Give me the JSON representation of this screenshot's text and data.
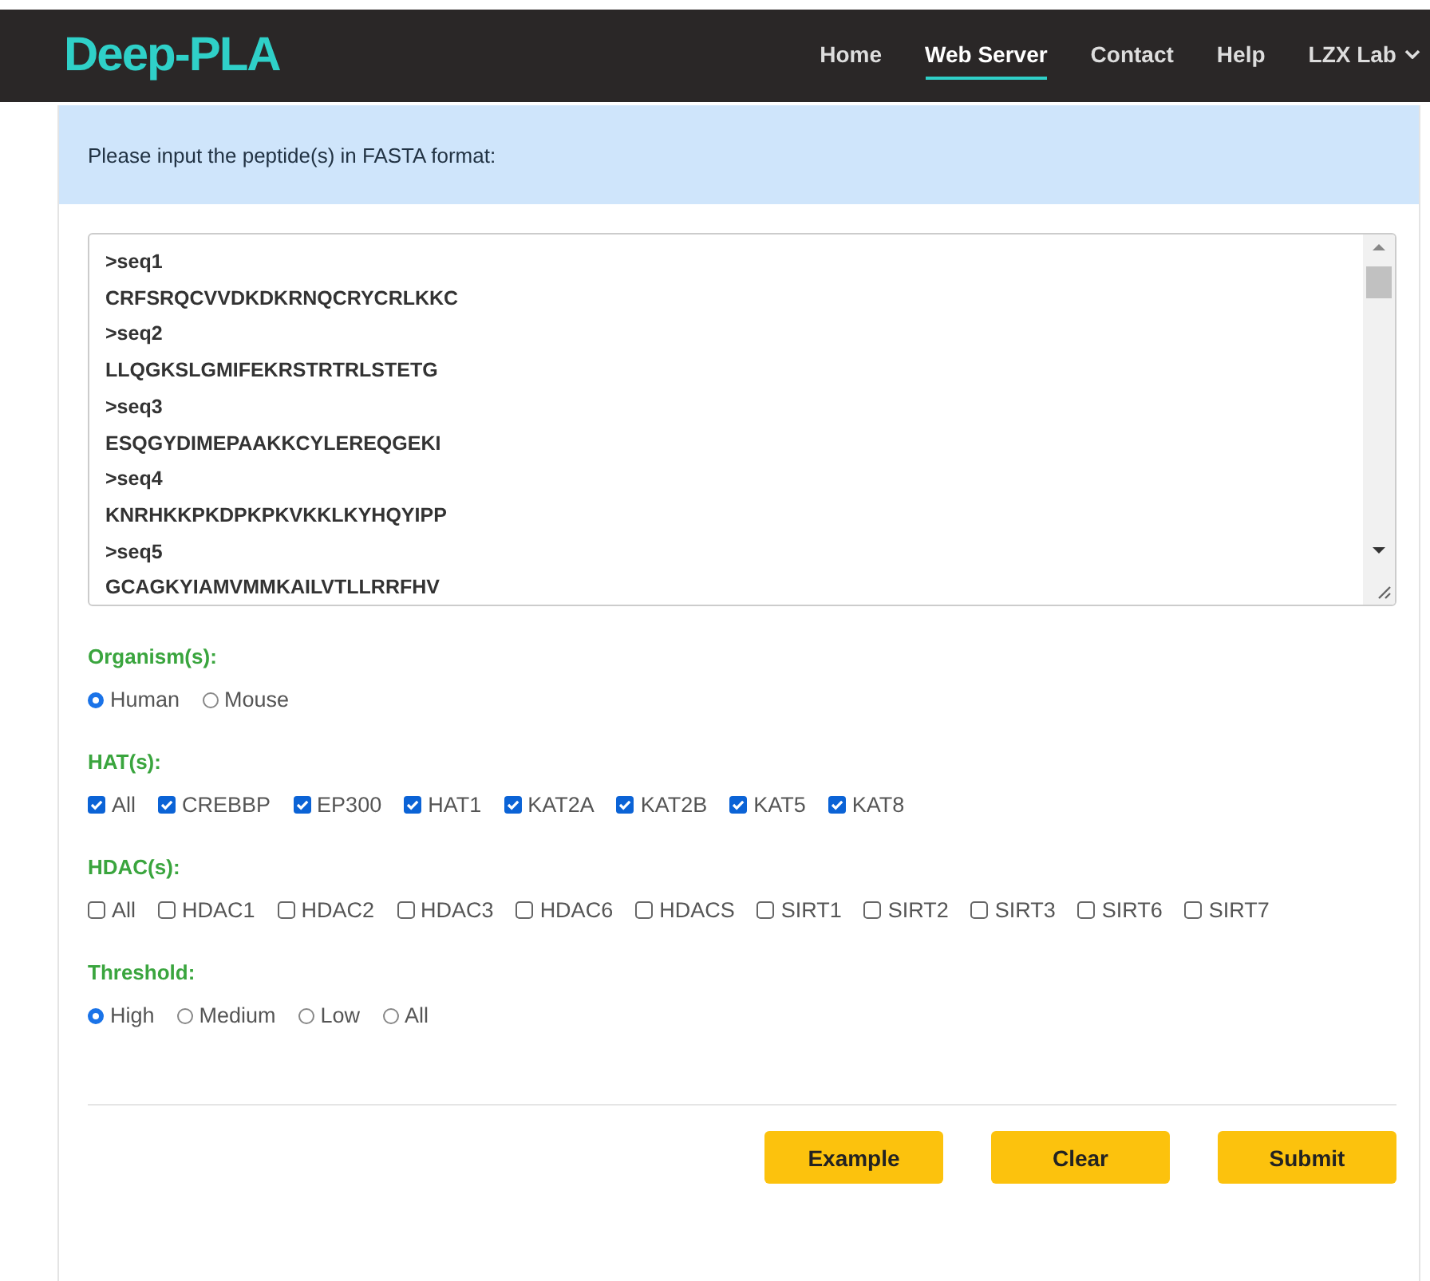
{
  "header": {
    "logo": "Deep-PLA",
    "nav": [
      {
        "label": "Home",
        "selected": false
      },
      {
        "label": "Web Server",
        "selected": true
      },
      {
        "label": "Contact",
        "selected": false
      },
      {
        "label": "Help",
        "selected": false
      },
      {
        "label": "LZX Lab",
        "selected": false,
        "dropdown": true
      }
    ]
  },
  "prompt": "Please input the peptide(s) in FASTA format:",
  "sequence_input": {
    "lines": [
      ">seq1",
      "CRFSRQCVVDKDKRNQCRYCRLKKC",
      ">seq2",
      "LLQGKSLGMIFEKRSTRTRLSTETG",
      ">seq3",
      "ESQGYDIMEPAAKKCYLEREQGEKI",
      ">seq4",
      "KNRHKKPKDPKPKVKKLKYHQYIPP",
      ">seq5",
      "GCAGKYIAMVMMKAILVTLLRRFHV"
    ]
  },
  "groups": [
    {
      "title": "Organism(s):",
      "kind": "radio",
      "options": [
        {
          "label": "Human",
          "selected": true
        },
        {
          "label": "Mouse",
          "selected": false
        }
      ]
    },
    {
      "title": "HAT(s):",
      "kind": "checkbox",
      "options": [
        {
          "label": "All",
          "checked": true
        },
        {
          "label": "CREBBP",
          "checked": true
        },
        {
          "label": "EP300",
          "checked": true
        },
        {
          "label": "HAT1",
          "checked": true
        },
        {
          "label": "KAT2A",
          "checked": true
        },
        {
          "label": "KAT2B",
          "checked": true
        },
        {
          "label": "KAT5",
          "checked": true
        },
        {
          "label": "KAT8",
          "checked": true
        }
      ]
    },
    {
      "title": "HDAC(s):",
      "kind": "checkbox",
      "options": [
        {
          "label": "All",
          "checked": false
        },
        {
          "label": "HDAC1",
          "checked": false
        },
        {
          "label": "HDAC2",
          "checked": false
        },
        {
          "label": "HDAC3",
          "checked": false
        },
        {
          "label": "HDAC6",
          "checked": false
        },
        {
          "label": "HDACS",
          "checked": false
        },
        {
          "label": "SIRT1",
          "checked": false
        },
        {
          "label": "SIRT2",
          "checked": false
        },
        {
          "label": "SIRT3",
          "checked": false
        },
        {
          "label": "SIRT6",
          "checked": false
        },
        {
          "label": "SIRT7",
          "checked": false
        }
      ]
    },
    {
      "title": "Threshold:",
      "kind": "radio",
      "options": [
        {
          "label": "High",
          "selected": true
        },
        {
          "label": "Medium",
          "selected": false
        },
        {
          "label": "Low",
          "selected": false
        },
        {
          "label": "All",
          "selected": false
        }
      ]
    }
  ],
  "buttons": [
    "Example",
    "Clear",
    "Submit"
  ]
}
